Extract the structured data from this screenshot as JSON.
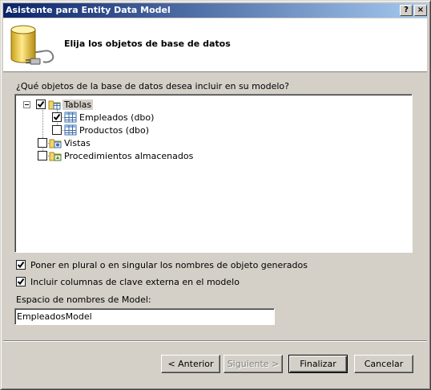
{
  "window": {
    "title": "Asistente para Entity Data Model",
    "help_button": "?",
    "close_button": "×"
  },
  "header": {
    "heading": "Elija los objetos de base de datos",
    "icon": "database-plug-icon"
  },
  "question": "¿Qué objetos de la base de datos desea incluir en su modelo?",
  "tree": {
    "nodes": [
      {
        "label": "Tablas",
        "checked": true,
        "expanded": true,
        "selected": true,
        "icon": "tables-folder-icon"
      },
      {
        "label": "Empleados (dbo)",
        "checked": true,
        "icon": "table-icon"
      },
      {
        "label": "Productos (dbo)",
        "checked": false,
        "icon": "table-icon"
      },
      {
        "label": "Vistas",
        "checked": false,
        "icon": "views-folder-icon"
      },
      {
        "label": "Procedimientos almacenados",
        "checked": false,
        "icon": "procedures-folder-icon"
      }
    ]
  },
  "options": {
    "pluralize": {
      "label": "Poner en plural o en singular los nombres de objeto generados",
      "checked": true
    },
    "foreign_keys": {
      "label": "Incluir columnas de clave externa en el modelo",
      "checked": true
    }
  },
  "namespace": {
    "label": "Espacio de nombres de Model:",
    "value": "EmpleadosModel"
  },
  "buttons": {
    "previous": "< Anterior",
    "next": "Siguiente >",
    "finish": "Finalizar",
    "cancel": "Cancelar"
  },
  "colors": {
    "titlebar_start": "#0a246a",
    "titlebar_end": "#a6caf0",
    "face": "#d4d0c8"
  }
}
